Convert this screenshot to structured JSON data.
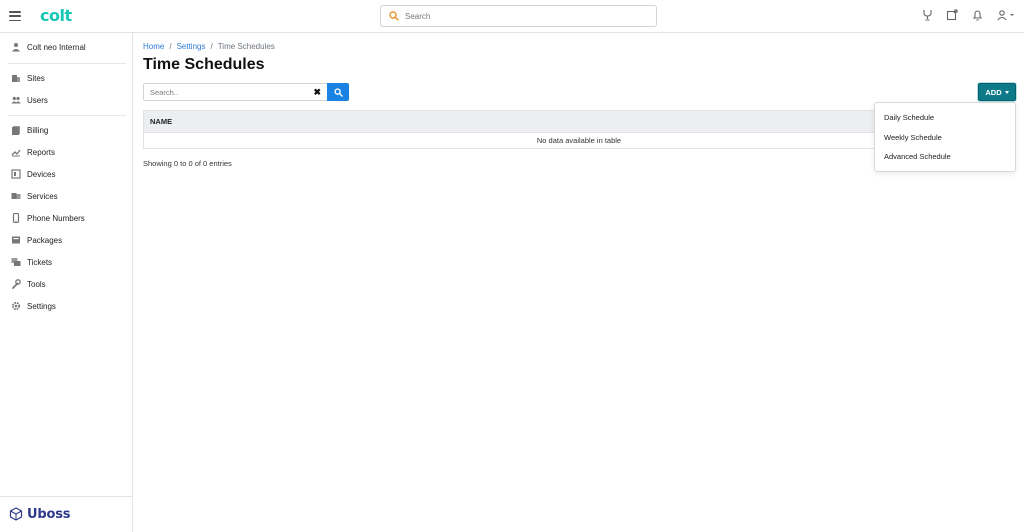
{
  "header": {
    "logo": "colt",
    "search_placeholder": "Search",
    "icons": [
      "handset-icon",
      "new-window-icon",
      "bell-icon",
      "user-menu-icon"
    ]
  },
  "sidebar": {
    "account": "Colt neo Internal",
    "items": [
      {
        "label": "Sites",
        "icon": "building-icon"
      },
      {
        "label": "Users",
        "icon": "users-icon"
      },
      {
        "label": "Billing",
        "icon": "billing-icon"
      },
      {
        "label": "Reports",
        "icon": "reports-icon"
      },
      {
        "label": "Devices",
        "icon": "devices-icon"
      },
      {
        "label": "Services",
        "icon": "services-icon"
      },
      {
        "label": "Phone Numbers",
        "icon": "phone-icon"
      },
      {
        "label": "Packages",
        "icon": "package-icon"
      },
      {
        "label": "Tickets",
        "icon": "tickets-icon"
      },
      {
        "label": "Tools",
        "icon": "wrench-icon"
      },
      {
        "label": "Settings",
        "icon": "gear-icon"
      }
    ],
    "footer_brand": "Uboss"
  },
  "breadcrumb": {
    "home": "Home",
    "settings": "Settings",
    "current": "Time Schedules",
    "separator": "/"
  },
  "page": {
    "title": "Time Schedules",
    "search_placeholder": "Search..",
    "clear_symbol": "✖",
    "add_label": "ADD",
    "column_name": "NAME",
    "empty_text": "No data available in table",
    "entries_text": "Showing 0 to 0 of 0 entries"
  },
  "add_menu": {
    "items": [
      "Daily Schedule",
      "Weekly Schedule",
      "Advanced Schedule"
    ]
  },
  "colors": {
    "brand": "#17c7b5",
    "add_button": "#0c7a89",
    "search_button": "#1a82e2",
    "link": "#2f7bd6"
  }
}
